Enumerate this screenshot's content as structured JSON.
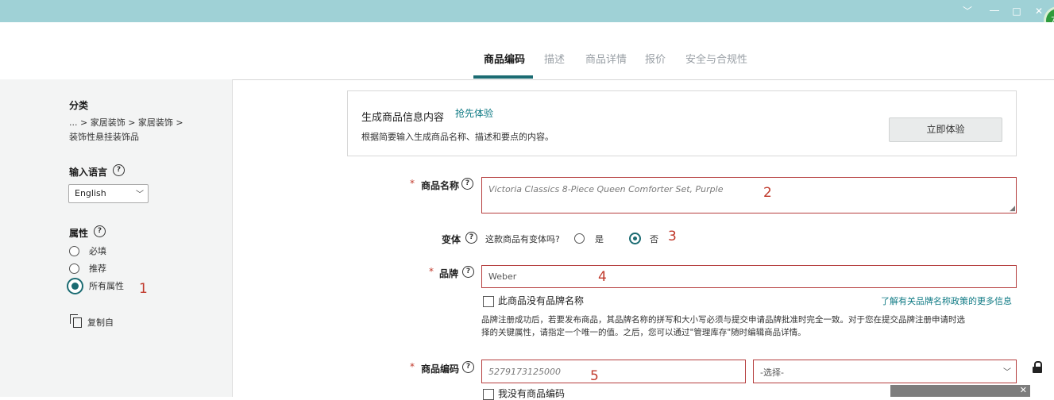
{
  "window": {
    "badge": "7",
    "minimize": "﹀",
    "maximize": "□",
    "close": "✕"
  },
  "tabs": [
    {
      "label": "商品编码",
      "active": true
    },
    {
      "label": "描述"
    },
    {
      "label": "商品详情"
    },
    {
      "label": "报价"
    },
    {
      "label": "安全与合规性"
    }
  ],
  "sidebar": {
    "category_title": "分类",
    "breadcrumb_line1": "... > 家居装饰 > 家居装饰 >",
    "breadcrumb_line2": "装饰性悬挂装饰品",
    "language_title": "输入语言",
    "language_value": "English",
    "attributes_title": "属性",
    "attributes": [
      {
        "label": "必填",
        "selected": false
      },
      {
        "label": "推荐",
        "selected": false
      },
      {
        "label": "所有属性",
        "selected": true
      }
    ],
    "copy_from": "复制自",
    "annotation": "1"
  },
  "generate": {
    "title": "生成商品信息内容",
    "title_link": "抢先体验",
    "desc": "根据简要输入生成商品名称、描述和要点的内容。",
    "button": "立即体验"
  },
  "form": {
    "name_label": "商品名称",
    "name_placeholder": "Victoria Classics 8-Piece Queen Comforter Set, Purple",
    "name_annotation": "2",
    "variant_label": "变体",
    "variant_question": "这款商品有变体吗?",
    "variant_yes": "是",
    "variant_no": "否",
    "variant_annotation": "3",
    "brand_label": "品牌",
    "brand_placeholder": "Weber",
    "brand_annotation": "4",
    "no_brand_label": "此商品没有品牌名称",
    "brand_policy_link": "了解有关品牌名称政策的更多信息",
    "brand_note_line1": "品牌注册成功后，若要发布商品，其品牌名称的拼写和大小写必须与提交申请品牌批准时完全一致。对于您在提交品牌注册申请时选",
    "brand_note_line2": "择的关键属性，请指定一个唯一的值。之后，您可以通过\"管理库存\"随时编辑商品详情。",
    "code_label": "商品编码",
    "code_placeholder": "5279173125000",
    "code_annotation": "5",
    "code_type_placeholder": "-选择-",
    "no_code_label": "我没有商品编码"
  }
}
